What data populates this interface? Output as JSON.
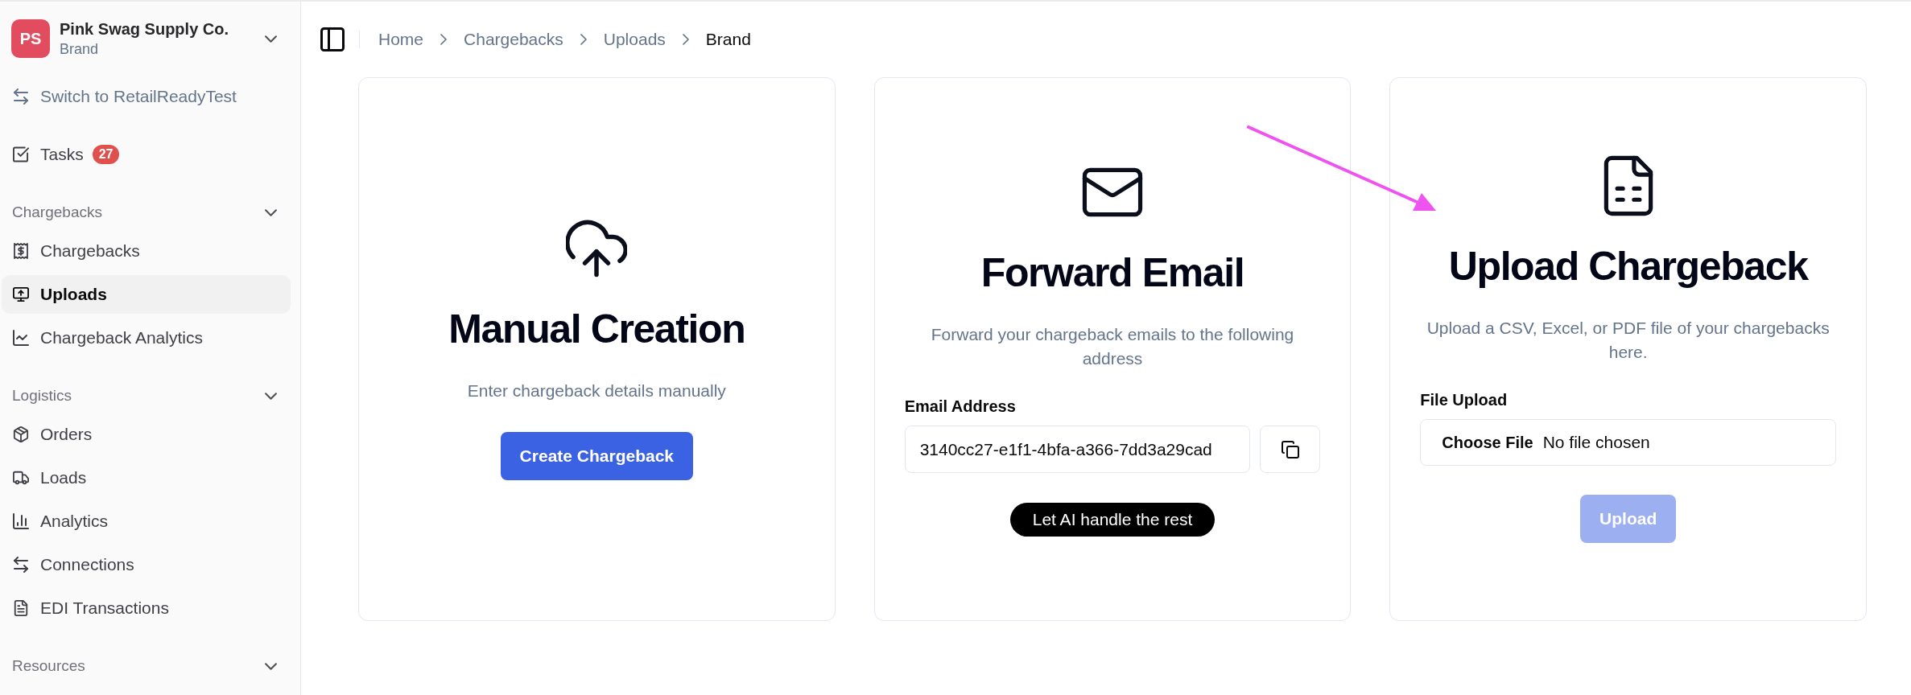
{
  "sidebar": {
    "org": {
      "initials": "PS",
      "name": "Pink Swag Supply Co.",
      "role": "Brand"
    },
    "switch_link": "Switch to RetailReadyTest",
    "tasks": {
      "label": "Tasks",
      "count": "27"
    },
    "sections": [
      {
        "title": "Chargebacks",
        "expanded": true,
        "items": [
          {
            "label": "Chargebacks",
            "selected": false
          },
          {
            "label": "Uploads",
            "selected": true
          },
          {
            "label": "Chargeback Analytics",
            "selected": false
          }
        ]
      },
      {
        "title": "Logistics",
        "expanded": true,
        "items": [
          {
            "label": "Orders",
            "selected": false
          },
          {
            "label": "Loads",
            "selected": false
          },
          {
            "label": "Analytics",
            "selected": false
          },
          {
            "label": "Connections",
            "selected": false
          },
          {
            "label": "EDI Transactions",
            "selected": false
          }
        ]
      },
      {
        "title": "Resources",
        "expanded": true
      }
    ]
  },
  "breadcrumb": [
    {
      "label": "Home",
      "current": false
    },
    {
      "label": "Chargebacks",
      "current": false
    },
    {
      "label": "Uploads",
      "current": false
    },
    {
      "label": "Brand",
      "current": true
    }
  ],
  "cards": [
    {
      "kind": "manual",
      "title": "Manual Creation",
      "description": "Enter chargeback details manually",
      "button": {
        "label": "Create Chargeback",
        "disabled": false
      }
    },
    {
      "kind": "email",
      "title": "Forward Email",
      "description": "Forward your chargeback emails to the following address",
      "field_label": "Email Address",
      "value": "3140cc27-e1f1-4bfa-a366-7dd3a29cad",
      "note": "Let AI handle the rest"
    },
    {
      "kind": "upload",
      "title": "Upload Chargeback",
      "description": "Upload a CSV, Excel, or PDF file of your chargebacks here.",
      "field_label": "File Upload",
      "file_button": "Choose File",
      "file_status": "No file chosen",
      "button": {
        "label": "Upload",
        "disabled": true
      }
    }
  ]
}
